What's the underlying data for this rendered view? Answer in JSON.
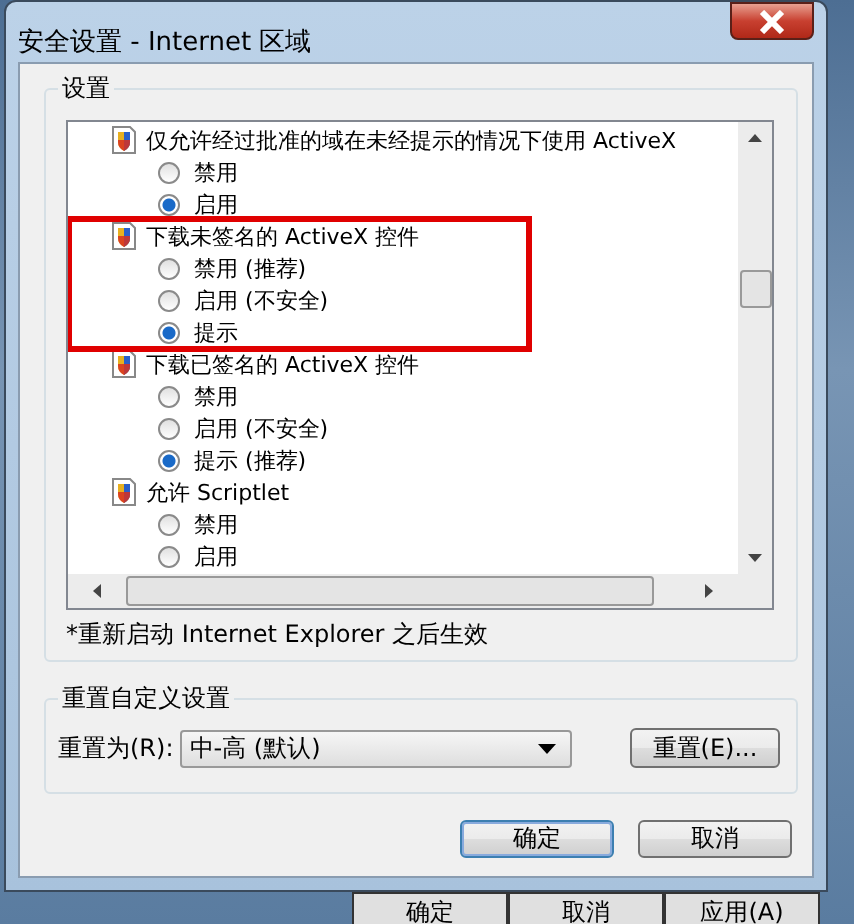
{
  "window": {
    "title": "安全设置 - Internet 区域"
  },
  "settings": {
    "label": "设置",
    "items": [
      {
        "label": "仅允许经过批准的域在未经提示的情况下使用 ActiveX",
        "highlighted": false,
        "options": [
          {
            "label": "禁用",
            "selected": false
          },
          {
            "label": "启用",
            "selected": true
          }
        ]
      },
      {
        "label": "下载未签名的 ActiveX 控件",
        "highlighted": true,
        "options": [
          {
            "label": "禁用 (推荐)",
            "selected": false
          },
          {
            "label": "启用 (不安全)",
            "selected": false
          },
          {
            "label": "提示",
            "selected": true
          }
        ]
      },
      {
        "label": "下载已签名的 ActiveX 控件",
        "highlighted": false,
        "options": [
          {
            "label": "禁用",
            "selected": false
          },
          {
            "label": "启用 (不安全)",
            "selected": false
          },
          {
            "label": "提示 (推荐)",
            "selected": true
          }
        ]
      },
      {
        "label": "允许 Scriptlet",
        "highlighted": false,
        "options": [
          {
            "label": "禁用",
            "selected": false
          },
          {
            "label": "启用",
            "selected": false
          }
        ]
      }
    ],
    "note": "*重新启动 Internet Explorer 之后生效"
  },
  "reset": {
    "label": "重置自定义设置",
    "field_label": "重置为(R):",
    "value": "中-高 (默认)",
    "button": "重置(E)..."
  },
  "buttons": [
    {
      "label": "确定",
      "default": true
    },
    {
      "label": "取消",
      "default": false
    }
  ],
  "background_buttons": [
    "确定",
    "取消",
    "应用(A)"
  ]
}
